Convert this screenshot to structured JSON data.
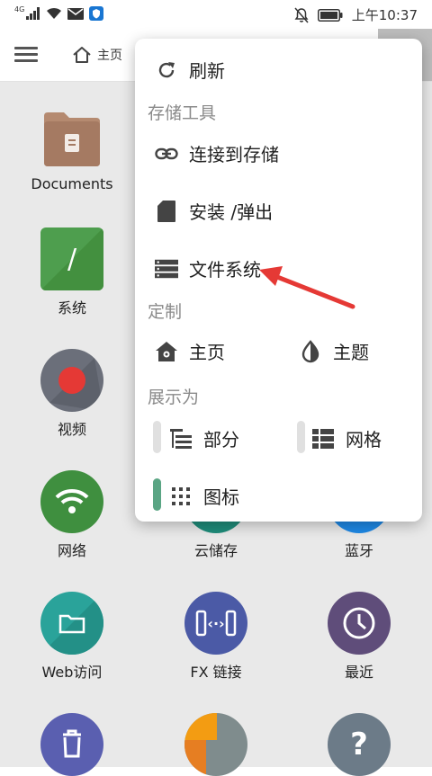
{
  "status": {
    "network": "4G",
    "time": "上午10:37"
  },
  "toolbar": {
    "home_label": "主页"
  },
  "grid": {
    "documents": "Documents",
    "system": "系统",
    "system_glyph": "/",
    "video": "视频",
    "network": "网络",
    "cloud": "云储存",
    "bluetooth": "蓝牙",
    "web": "Web访问",
    "fx": "FX 链接",
    "fx_glyph": "‹·›",
    "recent": "最近",
    "help_glyph": "?"
  },
  "menu": {
    "refresh": "刷新",
    "storage_tools": "存储工具",
    "connect": "连接到存储",
    "mount": "安装 /弹出",
    "filesystem": "文件系统",
    "customize": "定制",
    "home": "主页",
    "theme": "主题",
    "display_as": "展示为",
    "partial": "部分",
    "grid": "网格",
    "icons": "图标"
  },
  "colors": {
    "selected_toggle": "#5aa584",
    "arrow": "#e53935"
  }
}
